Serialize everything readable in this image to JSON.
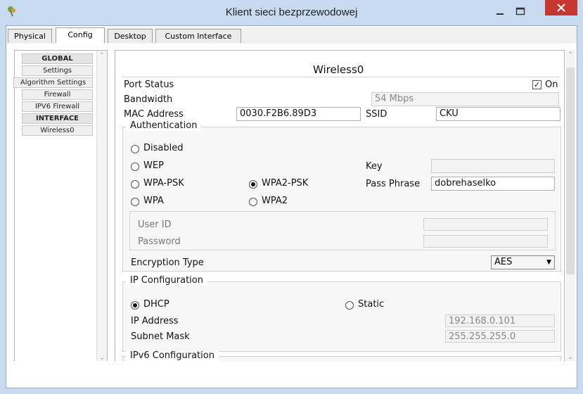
{
  "window": {
    "title": "Klient sieci bezprzewodowej",
    "close_color": "#c7372f"
  },
  "tabs": [
    {
      "label": "Physical"
    },
    {
      "label": "Config"
    },
    {
      "label": "Desktop"
    },
    {
      "label": "Custom Interface"
    }
  ],
  "sidebar": {
    "items": [
      {
        "label": "GLOBAL"
      },
      {
        "label": "Settings"
      },
      {
        "label": "Algorithm Settings"
      },
      {
        "label": "Firewall"
      },
      {
        "label": "IPV6 Firewall"
      },
      {
        "label": "INTERFACE"
      },
      {
        "label": "Wireless0"
      }
    ]
  },
  "panel": {
    "title": "Wireless0",
    "port_status_label": "Port Status",
    "port_on_label": "On",
    "port_on_checked": true,
    "bandwidth_label": "Bandwidth",
    "bandwidth_value": "54 Mbps",
    "mac_label": "MAC Address",
    "mac_value": "0030.F2B6.89D3",
    "ssid_label": "SSID",
    "ssid_value": "CKU",
    "auth": {
      "title": "Authentication",
      "disabled": "Disabled",
      "wep": "WEP",
      "wpa_psk": "WPA-PSK",
      "wpa2_psk": "WPA2-PSK",
      "wpa": "WPA",
      "wpa2": "WPA2",
      "selected": "WPA2-PSK",
      "key_label": "Key",
      "key_value": "",
      "pass_label": "Pass Phrase",
      "pass_value": "dobrehaselko",
      "user_id_label": "User ID",
      "password_label": "Password",
      "enc_label": "Encryption Type",
      "enc_value": "AES"
    },
    "ip": {
      "title": "IP Configuration",
      "dhcp": "DHCP",
      "static": "Static",
      "selected": "DHCP",
      "ip_label": "IP Address",
      "ip_value": "192.168.0.101",
      "mask_label": "Subnet Mask",
      "mask_value": "255.255.255.0"
    },
    "ipv6_title": "IPv6 Configuration"
  }
}
